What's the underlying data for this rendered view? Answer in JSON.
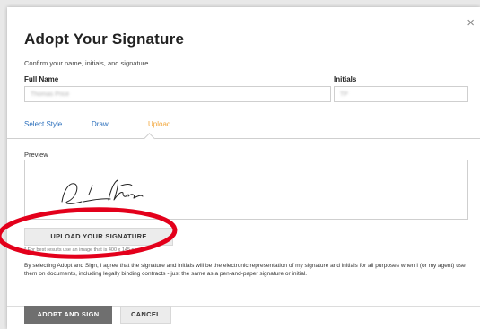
{
  "dialog": {
    "title": "Adopt Your Signature",
    "close_symbol": "×",
    "subtitle": "Confirm your name, initials, and signature."
  },
  "fields": {
    "full_name": {
      "label": "Full Name",
      "value": "Thomas Price"
    },
    "initials": {
      "label": "Initials",
      "value": "TP"
    }
  },
  "tabs": [
    {
      "label": "Select Style",
      "active": false
    },
    {
      "label": "Draw",
      "active": false
    },
    {
      "label": "Upload",
      "active": true
    }
  ],
  "preview": {
    "label": "Preview"
  },
  "upload": {
    "button_label": "UPLOAD YOUR SIGNATURE",
    "hint": "* For best results use an image that is 400 x 145 pixels"
  },
  "legal_text": "By selecting Adopt and Sign, I agree that the signature and initials will be the electronic representation of my signature and initials for all purposes when I (or my agent) use them on documents, including legally binding contracts - just the same as a pen-and-paper signature or initial.",
  "footer": {
    "adopt_label": "ADOPT AND SIGN",
    "cancel_label": "CANCEL"
  },
  "colors": {
    "link": "#2a6ebb",
    "active_tab": "#f2a63a",
    "annotation": "#e3001b",
    "primary_button": "#6f6f6f"
  }
}
